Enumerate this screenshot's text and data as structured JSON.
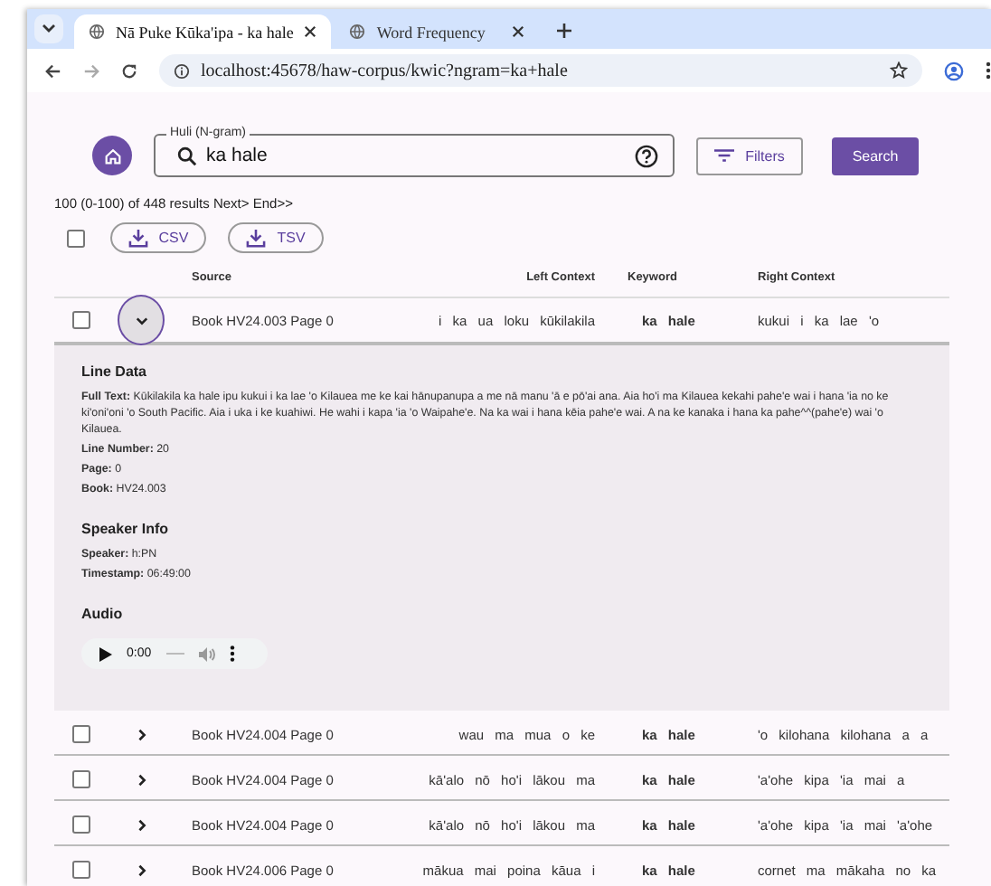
{
  "browser": {
    "tabs": [
      {
        "title": "Nā Puke Kūka'ipa - ka hale",
        "selected": true
      },
      {
        "title": "Word Frequency",
        "selected": false
      }
    ],
    "url": "localhost:45678/haw-corpus/kwic?ngram=ka+hale"
  },
  "search": {
    "label": "Huli (N-gram)",
    "value": "ka hale",
    "filters": "Filters",
    "submit": "Search"
  },
  "summary": "100 (0-100) of 448 results Next> End>>",
  "select_all_checked": false,
  "exports": [
    "CSV",
    "TSV"
  ],
  "columns": [
    "Source",
    "Left Context",
    "Keyword",
    "Right Context"
  ],
  "rows": [
    {
      "checked": false,
      "expanded": true,
      "source": "Book HV24.003 Page 0",
      "left": "i ka ua loku kūkilakila",
      "keyword": "ka hale",
      "right": "kukui i ka lae 'o"
    },
    {
      "checked": false,
      "expanded": false,
      "source": "Book HV24.004 Page 0",
      "left": "wau ma mua o ke",
      "keyword": "ka hale",
      "right": "'o kilohana kilohana a a"
    },
    {
      "checked": false,
      "expanded": false,
      "source": "Book HV24.004 Page 0",
      "left": "kā'alo nō ho'i lākou ma",
      "keyword": "ka hale",
      "right": "'a'ohe kipa 'ia mai a"
    },
    {
      "checked": false,
      "expanded": false,
      "source": "Book HV24.004 Page 0",
      "left": "kā'alo nō ho'i lākou ma",
      "keyword": "ka hale",
      "right": "'a'ohe kipa 'ia mai 'a'ohe"
    },
    {
      "checked": false,
      "expanded": false,
      "source": "Book HV24.006 Page 0",
      "left": "mākua mai poina kāua i",
      "keyword": "ka hale",
      "right": "cornet ma mākaha no ka"
    }
  ],
  "details": {
    "sections": [
      {
        "title": "Line Data",
        "fields": [
          {
            "label": "Full Text:",
            "value": "Kūkilakila ka hale ipu kukui i ka lae 'o Kilauea me ke kai hānupanupa a me nā manu 'ā e pō'ai ana. Aia ho'i ma Kilauea kekahi pahe'e wai i hana 'ia no ke ki'oni'oni 'o South Pacific. Aia i uka i ke kuahiwi. He wahi i kapa 'ia 'o Waipahe'e. Na ka wai i hana kēia pahe'e wai. A na ke kanaka i hana ka pahe^^(pahe'e) wai 'o Kilauea."
          },
          {
            "label": "Line Number:",
            "value": "20"
          },
          {
            "label": "Page:",
            "value": "0"
          },
          {
            "label": "Book:",
            "value": "HV24.003"
          }
        ]
      },
      {
        "title": "Speaker Info",
        "fields": [
          {
            "label": "Speaker:",
            "value": "h:PN"
          },
          {
            "label": "Timestamp:",
            "value": "06:49:00"
          }
        ]
      },
      {
        "title": "Audio",
        "audio": {
          "time": "0:00"
        }
      }
    ]
  }
}
